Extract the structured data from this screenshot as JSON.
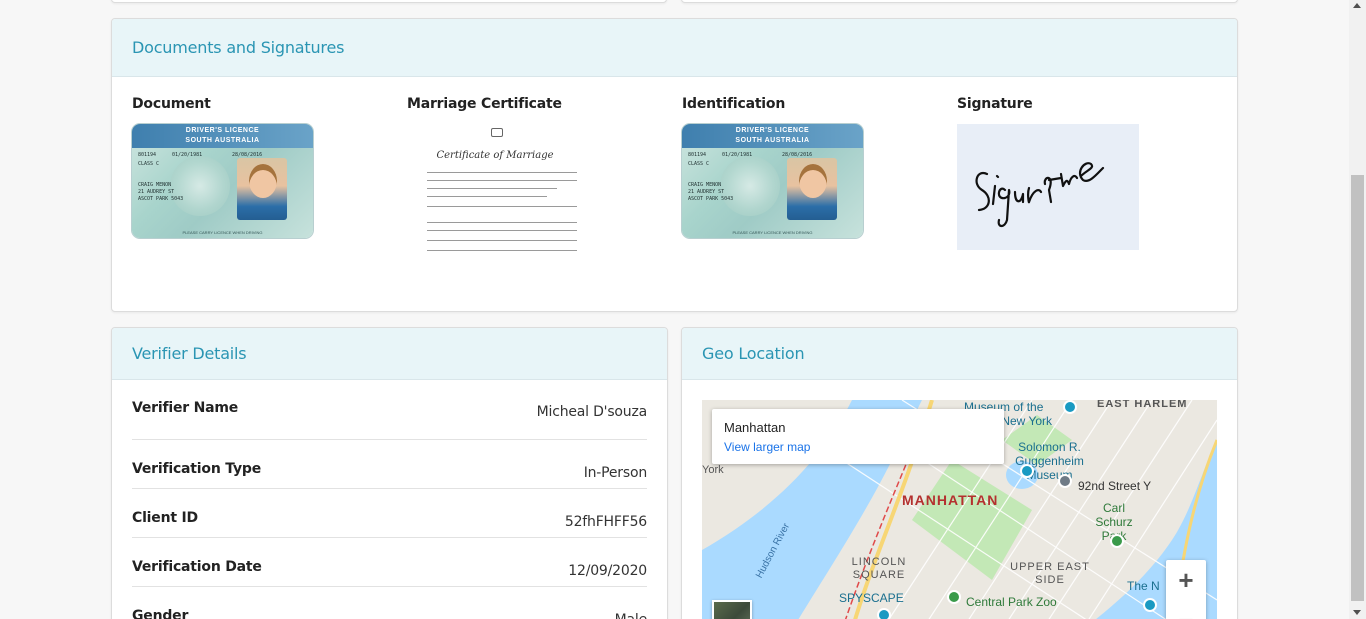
{
  "documents_card": {
    "title": "Documents and Signatures",
    "items": [
      {
        "label": "Document",
        "image": "drivers-licence-image"
      },
      {
        "label": "Marriage Certificate",
        "image": "marriage-certificate-image"
      },
      {
        "label": "Identification",
        "image": "drivers-licence-image"
      },
      {
        "label": "Signature",
        "image": "signature-image"
      }
    ],
    "licence": {
      "heading_line1": "DRIVER'S LICENCE",
      "heading_line2": "SOUTH AUSTRALIA",
      "number": "801194",
      "dob": "01/20/1981",
      "expiry": "28/08/2016",
      "class": "CLASS C",
      "name": "CRAIG MENON",
      "address1": "21 AUDREY ST",
      "address2": "ASCOT PARK 5043",
      "footer": "PLEASE CARRY LICENCE WHEN DRIVING"
    },
    "certificate": {
      "title": "Certificate of Marriage"
    }
  },
  "verifier_card": {
    "title": "Verifier Details",
    "rows": [
      {
        "label": "Verifier Name",
        "value": "Micheal D'souza"
      },
      {
        "label": "Verification Type",
        "value": "In-Person"
      },
      {
        "label": "Client ID",
        "value": "52fhFHFF56"
      },
      {
        "label": "Verification Date",
        "value": "12/09/2020"
      },
      {
        "label": "Gender",
        "value": "Male"
      }
    ]
  },
  "geo_card": {
    "title": "Geo Location",
    "map": {
      "place_name": "Manhattan",
      "view_larger": "View larger map",
      "labels": {
        "manhattan": "MANHATTAN",
        "east_harlem": "EAST HARLEM",
        "museum_of_the_city": "Museum of the City of New York",
        "guggenheim": "Solomon R. Guggenheim Museum",
        "street_92": "92nd Street Y",
        "carl_schurz": "Carl Schurz Park",
        "lincoln_square": "LINCOLN SQUARE",
        "upper_east_side": "UPPER EAST SIDE",
        "spyscape": "SPYSCAPE",
        "central_park_zoo": "Central Park Zoo",
        "hudson_river": "Hudson River",
        "the_n": "The N",
        "york": "York"
      },
      "zoom_in": "+",
      "zoom_out": "−"
    }
  }
}
